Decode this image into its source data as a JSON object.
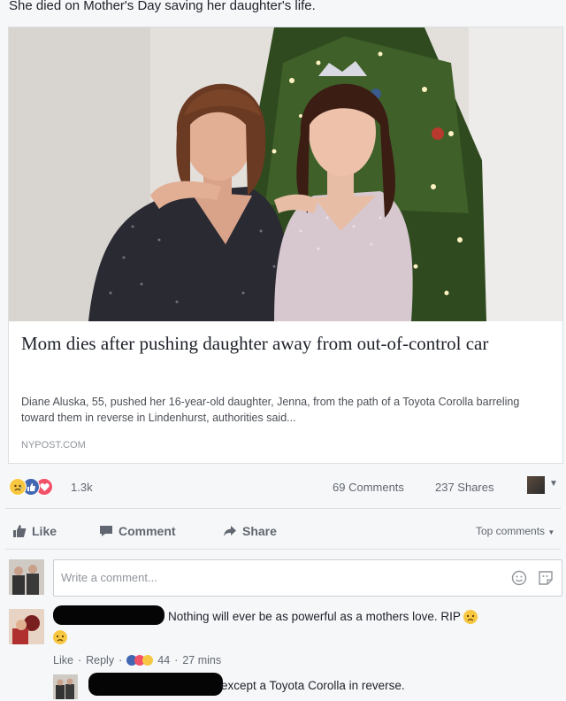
{
  "post": {
    "text": "She died on Mother's Day saving her daughter's life."
  },
  "link": {
    "title": "Mom dies after pushing daughter away from out-of-control car",
    "description": "Diane Aluska, 55, pushed her 16-year-old daughter, Jenna, from the path of a Toyota Corolla barreling toward them in reverse in Lindenhurst, authorities said...",
    "domain": "NYPOST.COM"
  },
  "reactions": {
    "count": "1.3k",
    "comments": "69 Comments",
    "shares": "237 Shares",
    "icons": [
      "sad-icon",
      "like-icon",
      "love-icon"
    ]
  },
  "actions": {
    "like": "Like",
    "comment": "Comment",
    "share": "Share",
    "sort": "Top comments"
  },
  "composer": {
    "placeholder": "Write a comment..."
  },
  "comments": [
    {
      "text": "Nothing will ever be as powerful as a mothers love. RIP",
      "like": "Like",
      "reply": "Reply",
      "reaction_count": "44",
      "time": "27 mins"
    },
    {
      "text": "except a Toyota Corolla in reverse."
    }
  ],
  "colors": {
    "background": "#f6f7f9",
    "link_card": "#ffffff",
    "muted_text": "#616770",
    "like_blue": "#4267b2",
    "sad_yellow": "#f7c742",
    "love_red": "#f25268"
  }
}
